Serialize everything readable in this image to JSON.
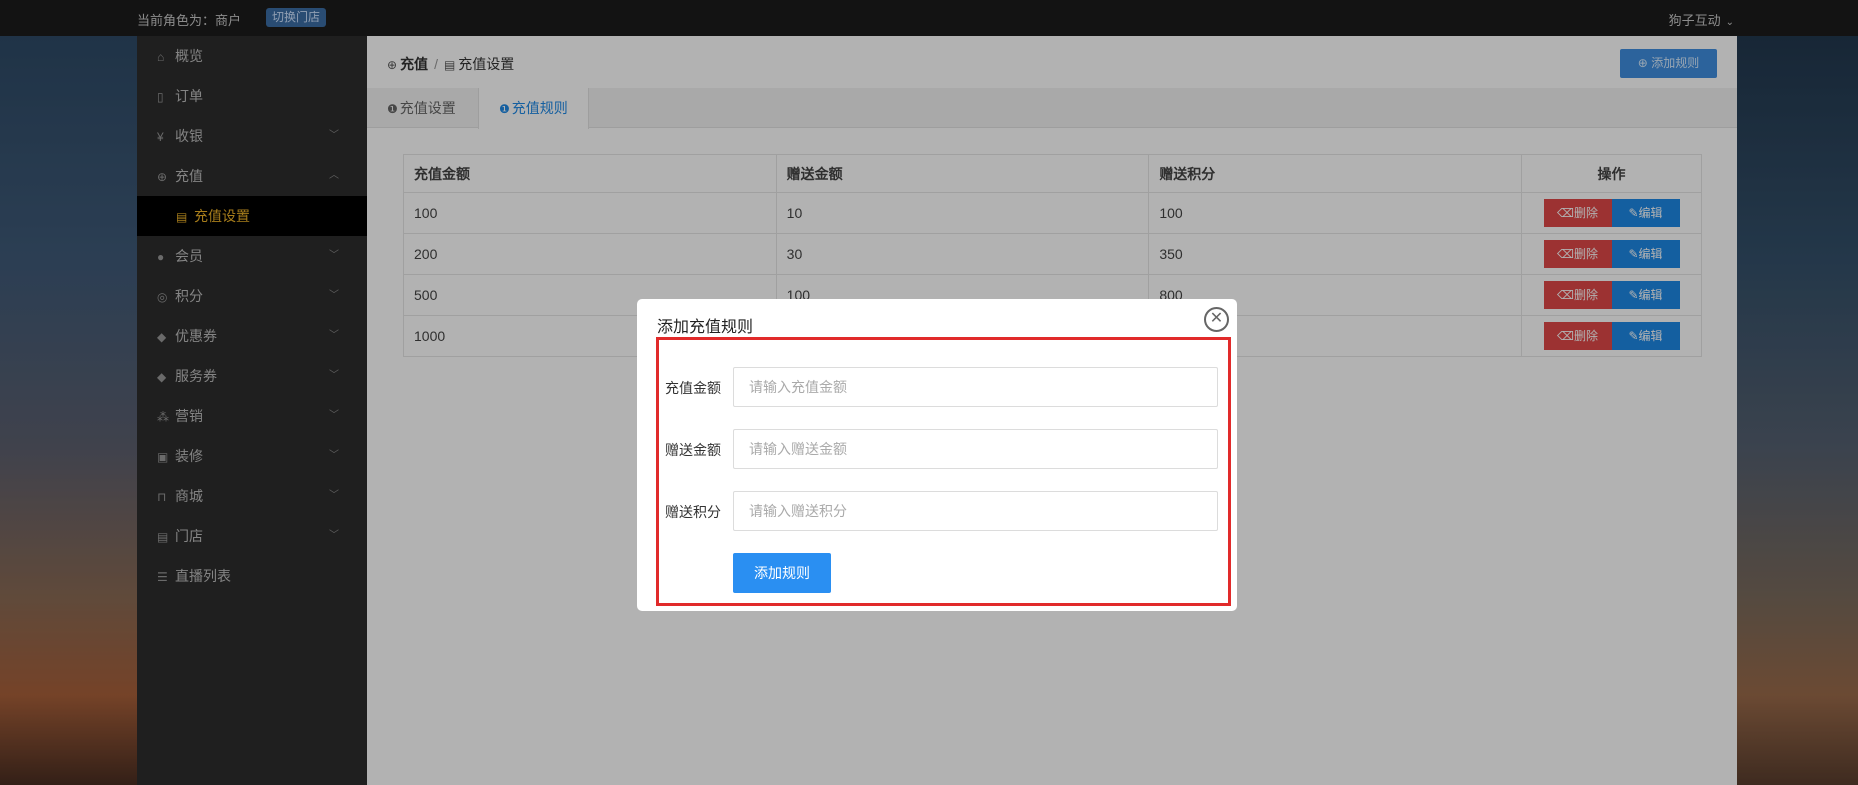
{
  "topbar": {
    "role_text": "当前角色为：商户",
    "switch_label": "切换门店",
    "user_name": "狗子互动"
  },
  "sidebar": {
    "items": [
      {
        "label": "概览",
        "icon": "home-icon"
      },
      {
        "label": "订单",
        "icon": "order-icon"
      },
      {
        "label": "收银",
        "icon": "cashier-icon"
      },
      {
        "label": "充值",
        "icon": "recharge-icon"
      },
      {
        "label": "充值设置",
        "icon": "store-icon"
      },
      {
        "label": "会员",
        "icon": "member-icon"
      },
      {
        "label": "积分",
        "icon": "points-icon"
      },
      {
        "label": "优惠券",
        "icon": "coupon-icon"
      },
      {
        "label": "服务券",
        "icon": "service-coupon-icon"
      },
      {
        "label": "营销",
        "icon": "marketing-icon"
      },
      {
        "label": "装修",
        "icon": "decoration-icon"
      },
      {
        "label": "商城",
        "icon": "mall-icon"
      },
      {
        "label": "门店",
        "icon": "shop-icon"
      },
      {
        "label": "直播列表",
        "icon": "live-list-icon"
      }
    ]
  },
  "breadcrumb": {
    "root": "充值",
    "separator": "/",
    "current": "充值设置"
  },
  "add_rule_top": "添加规则",
  "tabs": [
    {
      "label": "充值设置"
    },
    {
      "label": "充值规则"
    }
  ],
  "table": {
    "headers": [
      "充值金额",
      "赠送金额",
      "赠送积分",
      "操作"
    ],
    "rows": [
      [
        "100",
        "10",
        "100"
      ],
      [
        "200",
        "30",
        "350"
      ],
      [
        "500",
        "100",
        "800"
      ],
      [
        "1000",
        "",
        ""
      ]
    ],
    "delete_label": "删除",
    "edit_label": "编辑"
  },
  "modal": {
    "title": "添加充值规则",
    "fields": [
      {
        "label": "充值金额",
        "placeholder": "请输入充值金额",
        "value": ""
      },
      {
        "label": "赠送金额",
        "placeholder": "请输入赠送金额",
        "value": ""
      },
      {
        "label": "赠送积分",
        "placeholder": "请输入赠送积分",
        "value": ""
      }
    ],
    "submit_label": "添加规则"
  },
  "colors": {
    "accent": "#1e88e5",
    "danger": "#e04848",
    "highlight": "#e12a2a",
    "active_menu": "#f0b428"
  }
}
